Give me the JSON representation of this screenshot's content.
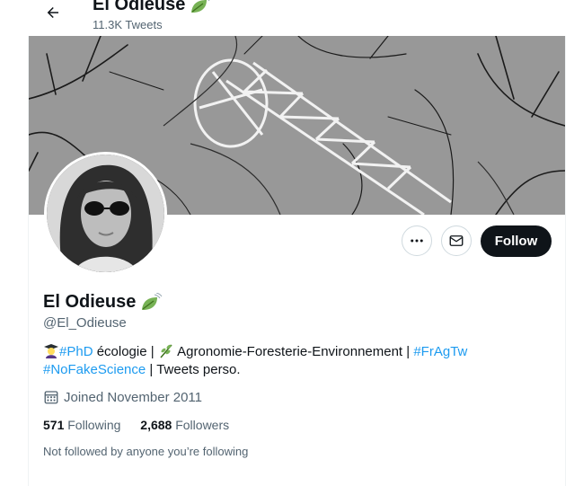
{
  "header": {
    "name": "El Odieuse",
    "tweet_count": "11.3K Tweets"
  },
  "profile": {
    "name": "El Odieuse",
    "handle": "@El_Odieuse",
    "bio": {
      "hashtag_phd": "#PhD",
      "text1": " écologie |",
      "text2": " Agronomie-Foresterie-Environnement |",
      "hashtag_fragtw": "#FrAgTw",
      "hashtag_nofakescience": "#NoFakeScience",
      "text3": " | Tweets perso."
    },
    "joined": "Joined November 2011",
    "following_count": "571",
    "following_label": "Following",
    "followers_count": "2,688",
    "followers_label": "Followers",
    "not_followed_text": "Not followed by anyone you’re following"
  },
  "actions": {
    "follow_label": "Follow"
  },
  "icons": {
    "back": "arrow-left-icon",
    "name_emoji": "leaf-fluttering-in-wind-icon",
    "more": "more-dots-icon",
    "message": "envelope-icon",
    "calendar": "calendar-icon",
    "bio_emoji_1": "student-icon",
    "bio_emoji_2": "herb-icon"
  },
  "colors": {
    "link": "#1d9bf0",
    "follow_bg": "#0f1419",
    "secondary_text": "#536471"
  }
}
